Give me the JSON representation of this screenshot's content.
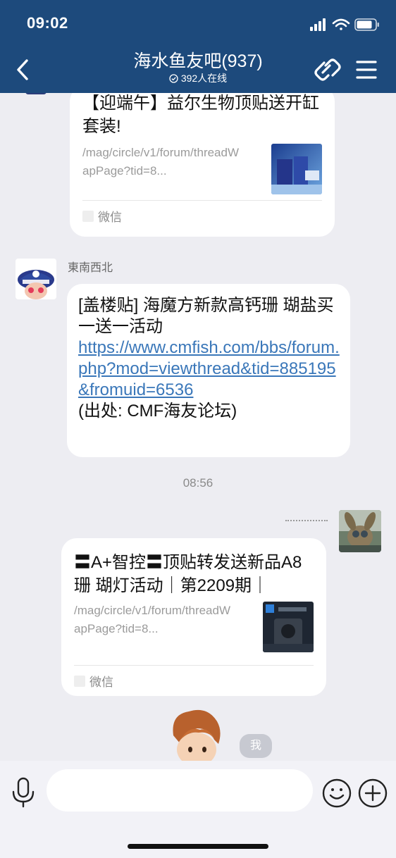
{
  "status_bar": {
    "time": "09:02"
  },
  "header": {
    "title": "海水鱼友吧(937)",
    "online": "392人在线"
  },
  "messages": {
    "card1": {
      "title": "【迎端午】益尔生物顶贴送开缸套装!",
      "desc": "/mag/circle/v1/forum/threadWapPage?tid=8...",
      "source": "微信"
    },
    "msg2": {
      "sender": "東南西北",
      "text_before": "[盖楼贴] 海魔方新款高钙珊 瑚盐买一送一活动",
      "link": "https://www.cmfish.com/bbs/forum.php?mod=viewthread&tid=885195&fromuid=6536",
      "text_after": "(出处: CMF海友论坛)"
    },
    "timestamp": "08:56",
    "card2": {
      "title": "〓A+智控〓顶贴转发送新品A8珊 瑚灯活动｜第2209期｜",
      "desc": "/mag/circle/v1/forum/threadWapPage?tid=8...",
      "source": "微信"
    },
    "me_badge": "我"
  },
  "input": {
    "placeholder": ""
  },
  "colors": {
    "header_bg": "#1d4a7c",
    "chat_bg": "#ededf2",
    "link": "#3a77b9"
  },
  "icons": [
    "back-icon",
    "link-icon",
    "menu-icon",
    "mic-icon",
    "emoji-icon",
    "plus-icon",
    "wechat-icon"
  ]
}
